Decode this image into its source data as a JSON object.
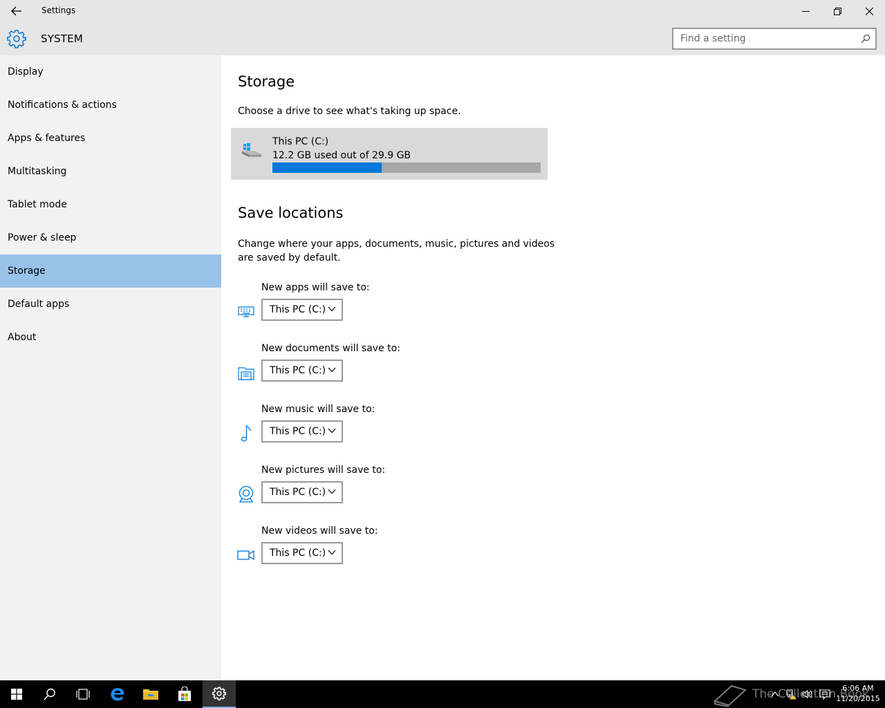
{
  "window": {
    "title": "Settings"
  },
  "header": {
    "section": "SYSTEM",
    "search_placeholder": "Find a setting"
  },
  "sidebar": {
    "items": [
      {
        "label": "Display"
      },
      {
        "label": "Notifications & actions"
      },
      {
        "label": "Apps & features"
      },
      {
        "label": "Multitasking"
      },
      {
        "label": "Tablet mode"
      },
      {
        "label": "Power & sleep"
      },
      {
        "label": "Storage"
      },
      {
        "label": "Default apps"
      },
      {
        "label": "About"
      }
    ],
    "selected_index": 6
  },
  "main": {
    "title": "Storage",
    "subtitle": "Choose a drive to see what's taking up space.",
    "drive": {
      "name": "This PC (C:)",
      "usage_text": "12.2 GB used out of 29.9 GB",
      "used_fraction": 0.408
    },
    "save_title": "Save locations",
    "save_desc_line1": "Change where your apps, documents, music, pictures and videos",
    "save_desc_line2": "are saved by default.",
    "locations": [
      {
        "label": "New apps will save to:",
        "value": "This PC (C:)",
        "icon": "keyboard-icon"
      },
      {
        "label": "New documents will save to:",
        "value": "This PC (C:)",
        "icon": "documents-icon"
      },
      {
        "label": "New music will save to:",
        "value": "This PC (C:)",
        "icon": "music-note-icon"
      },
      {
        "label": "New pictures will save to:",
        "value": "This PC (C:)",
        "icon": "webcam-icon"
      },
      {
        "label": "New videos will save to:",
        "value": "This PC (C:)",
        "icon": "video-camera-icon"
      }
    ]
  },
  "taskbar": {
    "time": "6:06 AM",
    "date": "11/20/2015",
    "watermark": "The Collection Book"
  },
  "colors": {
    "accent": "#0078d7",
    "selected_nav": "#99c2e8",
    "sidebar_bg": "#f2f2f2",
    "titlebar_bg": "#e6e6e6"
  }
}
